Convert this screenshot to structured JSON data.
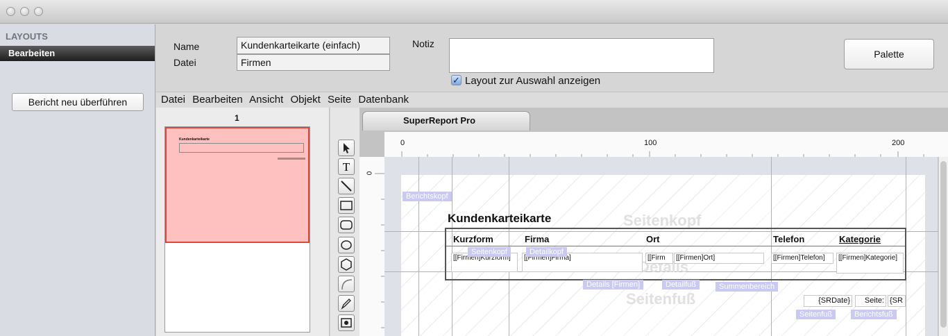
{
  "sidebar": {
    "heading": "LAYOUTS",
    "selected_item": "Bearbeiten",
    "action_button": "Bericht neu überführen"
  },
  "form": {
    "name_label": "Name",
    "name_value": "Kundenkarteikarte (einfach)",
    "file_label": "Datei",
    "file_value": "Firmen",
    "note_label": "Notiz",
    "note_value": "",
    "show_layout_label": "Layout zur Auswahl anzeigen",
    "show_layout_checked": true,
    "palette_button": "Palette"
  },
  "menu": [
    "Datei",
    "Bearbeiten",
    "Ansicht",
    "Objekt",
    "Seite",
    "Datenbank"
  ],
  "thumbnail": {
    "page_number": "1",
    "title": "Kundenkarteikarte"
  },
  "tools": [
    "arrow-icon",
    "text-tool-icon",
    "line-tool-icon",
    "rectangle-tool-icon",
    "rounded-rectangle-tool-icon",
    "oval-tool-icon",
    "polygon-tool-icon",
    "arc-tool-icon",
    "pencil-tool-icon",
    "picture-tool-icon"
  ],
  "editor": {
    "tab_label": "SuperReport Pro",
    "ruler_labels": [
      "0",
      "100",
      "200"
    ],
    "vruler_label": "0",
    "report_title": "Kundenkarteikarte",
    "columns": [
      "Kurzform",
      "Firma",
      "Ort",
      "Telefon",
      "Kategorie"
    ],
    "fields": [
      "[[Firmen]Kurzform]",
      "[[Firmen]Firma]",
      "[[Firm",
      "[[Firmen]Ort]",
      "[[Firmen]Telefon]",
      "[[Firmen]Kategorie]"
    ],
    "date_field": "{SRDate}",
    "page_label": "Seite:",
    "page_field": "{SR",
    "ghost_labels": {
      "header": "Seitenkopf",
      "details": "Details",
      "footer": "Seitenfuß"
    },
    "bands": {
      "report_header": "Berichtskopf",
      "page_header": "Seitenkopf",
      "detail_header": "Detailkopf",
      "details_firmen": "Details [Firmen]",
      "detail_footer": "Detailfuß",
      "summary": "Summenbereich",
      "page_footer": "Seitenfuß",
      "report_footer": "Berichtsfuß"
    }
  }
}
